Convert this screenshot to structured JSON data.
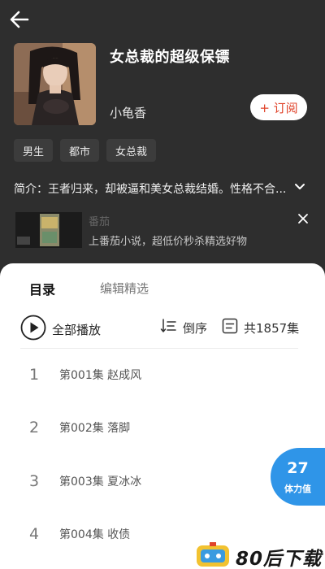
{
  "book": {
    "title": "女总裁的超级保镖",
    "author": "小龟香",
    "subscribe_label": "+ 订阅",
    "tags": [
      "男生",
      "都市",
      "女总裁"
    ],
    "intro": "简介：王者归来，却被逼和美女总裁结婚。性格不合..."
  },
  "promo": {
    "name": "番茄",
    "text": "上番茄小说，超低价秒杀精选好物"
  },
  "tabs": {
    "active": "目录",
    "inactive": "编辑精选"
  },
  "toolbar": {
    "play_all": "全部播放",
    "sort": "倒序",
    "count": "共1857集"
  },
  "episodes": [
    {
      "num": "1",
      "title": "第001集  赵成风"
    },
    {
      "num": "2",
      "title": "第002集  落脚"
    },
    {
      "num": "3",
      "title": "第003集  夏冰冰"
    },
    {
      "num": "4",
      "title": "第004集  收债"
    }
  ],
  "stamina": {
    "value": "27",
    "label": "体力值"
  },
  "watermark": "80后下载",
  "colors": {
    "header_bg": "#2e2e2e",
    "subscribe_text": "#e0442b",
    "badge_bg": "#2f95e8"
  }
}
